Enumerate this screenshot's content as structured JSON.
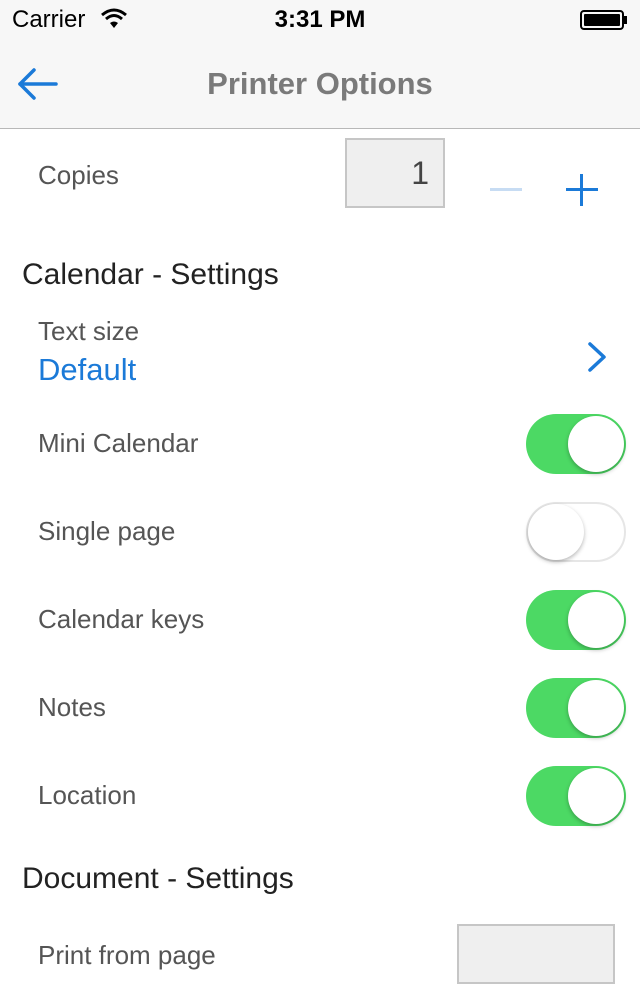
{
  "status_bar": {
    "carrier": "Carrier",
    "time": "3:31 PM"
  },
  "nav": {
    "title": "Printer Options",
    "back_icon": "back-arrow-icon"
  },
  "copies": {
    "label": "Copies",
    "value": "1",
    "minus_icon": "minus-icon",
    "plus_icon": "plus-icon"
  },
  "calendar_settings": {
    "header": "Calendar - Settings",
    "text_size": {
      "label": "Text size",
      "value": "Default",
      "chevron_icon": "chevron-right-icon"
    },
    "toggles": [
      {
        "label": "Mini Calendar",
        "on": true
      },
      {
        "label": "Single page",
        "on": false
      },
      {
        "label": "Calendar keys",
        "on": true
      },
      {
        "label": "Notes",
        "on": true
      },
      {
        "label": "Location",
        "on": true
      }
    ]
  },
  "document_settings": {
    "header": "Document - Settings",
    "print_from_page_label": "Print from page",
    "print_from_page_value": ""
  },
  "colors": {
    "accent": "#1b7ad8",
    "toggle_on": "#4cd964",
    "nav_background": "#f7f7f7"
  }
}
